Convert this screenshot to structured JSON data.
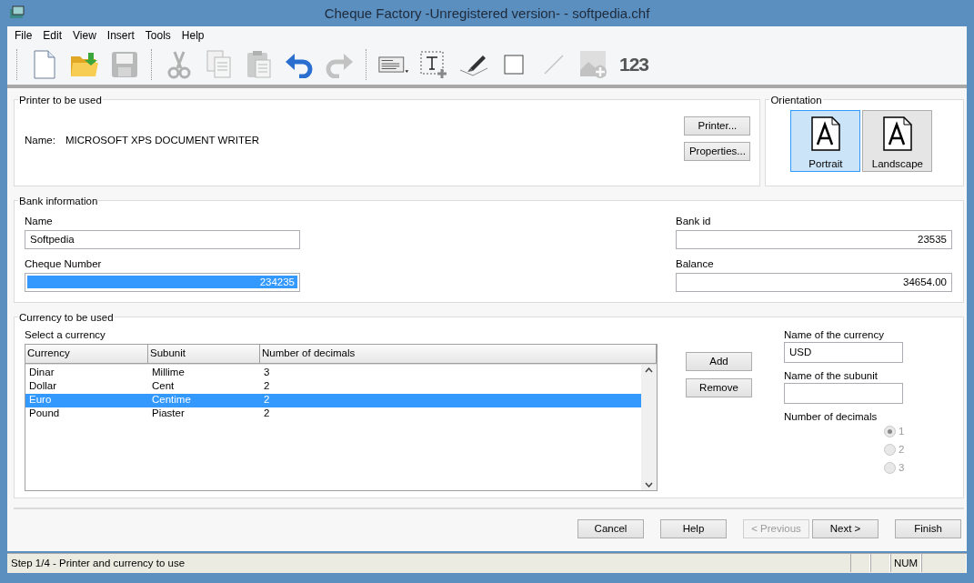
{
  "window": {
    "title": "Cheque Factory -Unregistered version- - softpedia.chf"
  },
  "menu": [
    "File",
    "Edit",
    "View",
    "Insert",
    "Tools",
    "Help"
  ],
  "toolbar": [
    {
      "kind": "new",
      "disabled": false
    },
    {
      "kind": "open",
      "disabled": false
    },
    {
      "kind": "save",
      "disabled": true
    },
    {
      "kind": "sep"
    },
    {
      "kind": "cut",
      "disabled": true
    },
    {
      "kind": "copy",
      "disabled": true
    },
    {
      "kind": "paste",
      "disabled": true
    },
    {
      "kind": "undo",
      "disabled": false
    },
    {
      "kind": "redo",
      "disabled": true
    },
    {
      "kind": "sep"
    },
    {
      "kind": "cheque",
      "disabled": false
    },
    {
      "kind": "text",
      "disabled": false
    },
    {
      "kind": "signature",
      "disabled": false
    },
    {
      "kind": "rect",
      "disabled": false
    },
    {
      "kind": "line",
      "disabled": true
    },
    {
      "kind": "image",
      "disabled": true
    },
    {
      "kind": "number",
      "label": "123",
      "disabled": false
    }
  ],
  "printer": {
    "title": "Printer to be used",
    "name_label": "Name:",
    "name": "MICROSOFT XPS DOCUMENT WRITER",
    "buttons": [
      "Printer...",
      "Properties..."
    ]
  },
  "orientation": {
    "title": "Orientation",
    "options": [
      {
        "label": "Portrait",
        "selected": true
      },
      {
        "label": "Landscape",
        "selected": false
      }
    ]
  },
  "bank": {
    "title": "Bank information",
    "name_label": "Name",
    "name": "Softpedia",
    "cheque_label": "Cheque Number",
    "cheque": "234235",
    "cheque_selected": true,
    "bank_id_label": "Bank id",
    "bank_id": "23535",
    "balance_label": "Balance",
    "balance": "34654.00"
  },
  "currency": {
    "title": "Currency to be used",
    "select_label": "Select a currency",
    "columns": [
      "Currency",
      "Subunit",
      "Number of decimals"
    ],
    "rows": [
      {
        "cells": [
          "Dinar",
          "Millime",
          "3"
        ],
        "selected": false
      },
      {
        "cells": [
          "Dollar",
          "Cent",
          "2"
        ],
        "selected": false
      },
      {
        "cells": [
          "Euro",
          "Centime",
          "2"
        ],
        "selected": true
      },
      {
        "cells": [
          "Pound",
          "Piaster",
          "2"
        ],
        "selected": false
      }
    ],
    "buttons": [
      "Add",
      "Remove"
    ],
    "currency_name_label": "Name of the currency",
    "currency_name": "USD",
    "subunit_label": "Name of the subunit",
    "decimals_label": "Number of decimals",
    "decimals": [
      {
        "label": "1",
        "selected": true,
        "disabled": true
      },
      {
        "label": "2",
        "selected": false,
        "disabled": true
      },
      {
        "label": "3",
        "selected": false,
        "disabled": true
      }
    ]
  },
  "wizard_buttons": [
    {
      "label": "Cancel",
      "disabled": false
    },
    {
      "label": "Help",
      "disabled": false
    },
    {
      "label": "< Previous",
      "disabled": true
    },
    {
      "label": "Next >",
      "disabled": false
    },
    {
      "label": "Finish",
      "disabled": false
    }
  ],
  "status_bar": {
    "text": "Step 1/4 - Printer and currency to use",
    "panels": [
      "NUM"
    ]
  }
}
